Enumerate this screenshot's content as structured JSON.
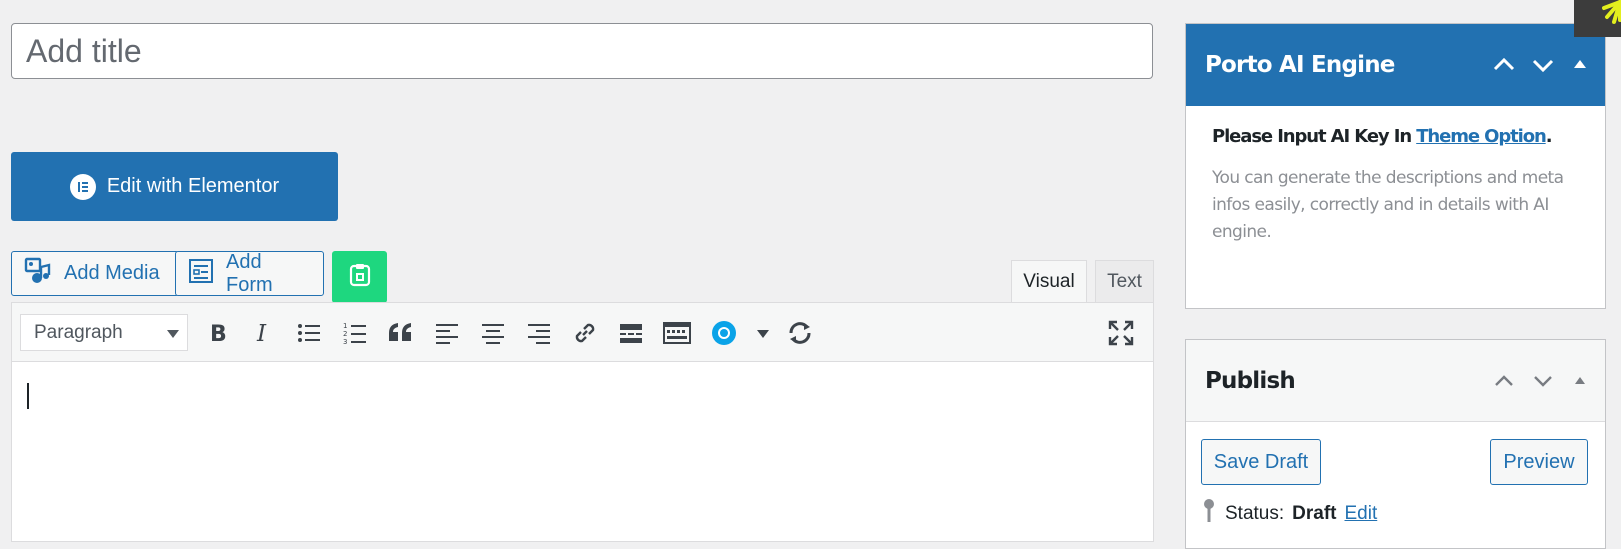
{
  "title_field": {
    "placeholder": "Add title",
    "value": ""
  },
  "elementor": {
    "label": "Edit with Elementor"
  },
  "media_buttons": {
    "add_media": "Add Media",
    "add_form": "Add Form"
  },
  "editor": {
    "tabs": {
      "visual": "Visual",
      "text": "Text"
    },
    "format_select": "Paragraph",
    "toolbar_icons": [
      "bold-icon",
      "italic-icon",
      "bullet-list-icon",
      "numbered-list-icon",
      "blockquote-icon",
      "align-left-icon",
      "align-center-icon",
      "align-right-icon",
      "link-icon",
      "read-more-icon",
      "toolbar-toggle-icon",
      "ring-dropdown-icon",
      "refresh-icon",
      "fullscreen-icon"
    ]
  },
  "ai_panel": {
    "title": "Porto AI Engine",
    "key_prefix": "Please Input AI Key In ",
    "key_link": "Theme Option",
    "key_suffix": ".",
    "description": "You can generate the descriptions and meta infos easily, correctly and in details with AI engine."
  },
  "publish_panel": {
    "title": "Publish",
    "save_draft": "Save Draft",
    "preview": "Preview",
    "status_label": "Status:",
    "status_value": "Draft",
    "status_edit": "Edit"
  },
  "colors": {
    "accent": "#2271b1",
    "background": "#f0f0f1",
    "green_button": "#1ed77f",
    "corner_badge_icon": "#e3ef1e"
  }
}
